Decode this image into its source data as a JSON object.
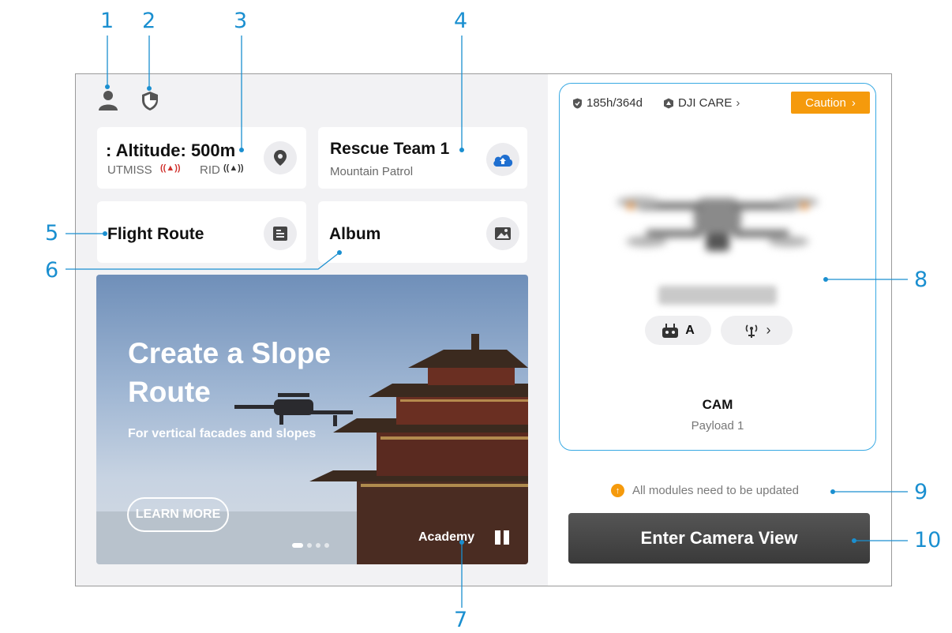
{
  "callouts": [
    "1",
    "2",
    "3",
    "4",
    "5",
    "6",
    "7",
    "8",
    "9",
    "10"
  ],
  "header": {
    "icons": [
      "user-icon",
      "shield-icon"
    ]
  },
  "cards": {
    "altitude": {
      "title": ": Altitude: 500m",
      "utmiss": "UTMISS",
      "rid": "RID",
      "icon": "location-pin-icon"
    },
    "team": {
      "title": "Rescue Team 1",
      "subtitle": "Mountain Patrol",
      "icon": "cloud-icon"
    },
    "route": {
      "title": "Flight Route",
      "icon": "route-list-icon"
    },
    "album": {
      "title": "Album",
      "icon": "image-icon"
    }
  },
  "banner": {
    "title": "Create a Slope Route",
    "subtitle": "For vertical facades and slopes",
    "button": "LEARN MORE",
    "academy": "Academy",
    "dots": 4,
    "active_dot": 0
  },
  "drone": {
    "hours": "185h/364d",
    "care": "DJI CARE",
    "caution": "Caution",
    "controller_label": "A",
    "camera": "CAM",
    "payload": "Payload 1"
  },
  "status": {
    "update": "All modules need to be updated"
  },
  "actions": {
    "enter": "Enter Camera View"
  },
  "colors": {
    "callout": "#1a8fd0",
    "caution": "#f59a0c",
    "card_border": "#38a9e3",
    "button_dark": "#3f3f3f"
  }
}
